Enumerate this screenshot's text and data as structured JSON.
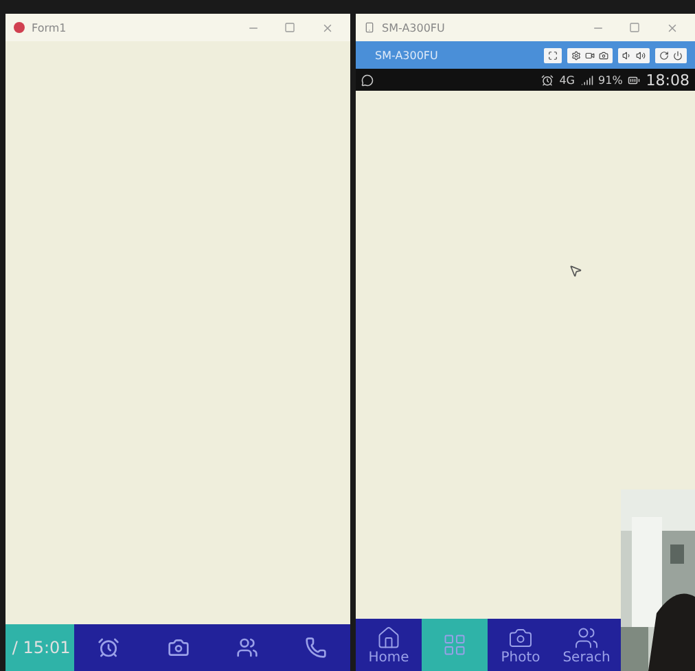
{
  "left_window": {
    "title": "Form1",
    "taskbar_time": "/ 15:01",
    "nav": [
      {
        "selected": true
      },
      {
        "selected": false
      },
      {
        "selected": false
      },
      {
        "selected": false
      },
      {
        "selected": false
      }
    ]
  },
  "right_window": {
    "title": "SM-A300FU",
    "toolbar_title": "SM-A300FU",
    "status_bar": {
      "network": "4G",
      "battery": "91%",
      "time": "18:08"
    },
    "nav": [
      {
        "label": "Home",
        "selected": false
      },
      {
        "selected": true
      },
      {
        "label": "Photo",
        "selected": false
      },
      {
        "label": "Serach",
        "selected": false
      }
    ]
  }
}
